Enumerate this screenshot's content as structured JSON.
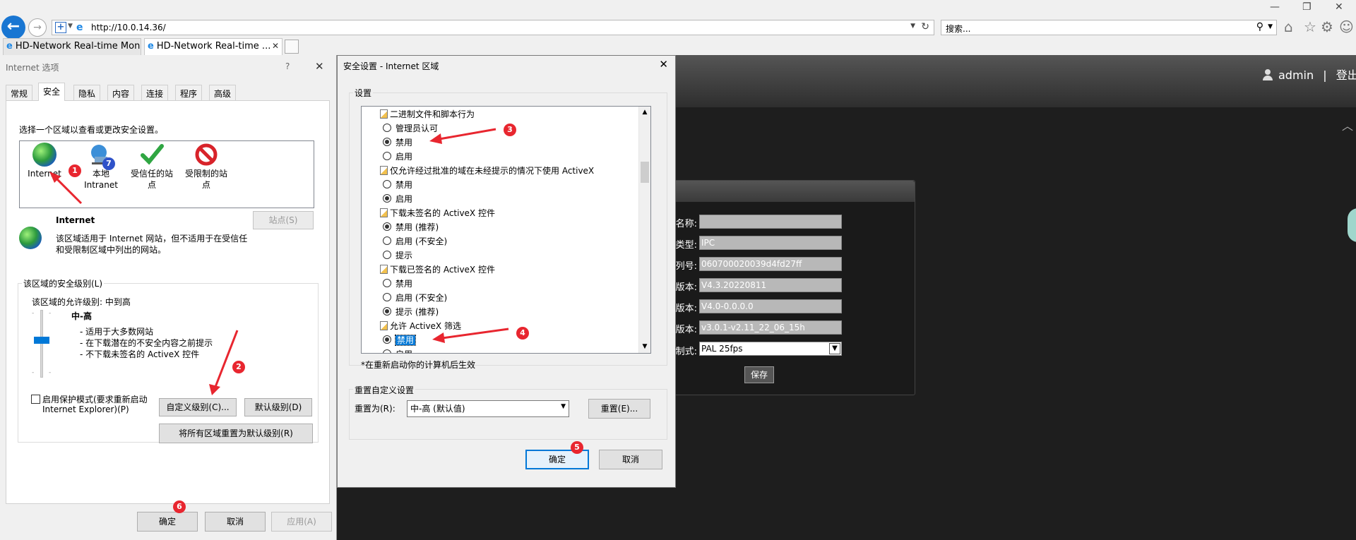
{
  "browser": {
    "url": "http://10.0.14.36/",
    "search_placeholder": "搜索...",
    "tabs": [
      {
        "label": "HD-Network Real-time Mon..."
      },
      {
        "label": "HD-Network Real-time ..."
      }
    ]
  },
  "web": {
    "user": "admin",
    "separator": "|",
    "logout": "登出",
    "labels": [
      "名称:",
      "类型:",
      "列号:",
      "版本:",
      "版本:",
      "版本:",
      "制式:"
    ],
    "fields": [
      "",
      "IPC",
      "060700020039d4fd27ff",
      "V4.3.20220811",
      "V4.0-0.0.0.0",
      "v3.0.1-v2.11_22_06_15h"
    ],
    "format_value": "PAL 25fps",
    "save_label": "保存"
  },
  "options_dialog": {
    "title": "Internet 选项",
    "help": "?",
    "tabs": [
      "常规",
      "安全",
      "隐私",
      "内容",
      "连接",
      "程序",
      "高级"
    ],
    "zone_prompt": "选择一个区域以查看或更改安全设置。",
    "zones": [
      {
        "label": "Internet"
      },
      {
        "label_line1": "本地",
        "label_line2": "Intranet"
      },
      {
        "label_line1": "受信任的站",
        "label_line2": "点"
      },
      {
        "label_line1": "受限制的站",
        "label_line2": "点"
      }
    ],
    "zone_name": "Internet",
    "sites_button": "站点(S)",
    "zone_desc_line1": "该区域适用于 Internet 网站，但不适用于在受信任",
    "zone_desc_line2": "和受限制区域中列出的网站。",
    "level_group": "该区域的安全级别(L)",
    "allowed_level": "该区域的允许级别: 中到高",
    "level_name": "中-高",
    "level_points": [
      "- 适用于大多数网站",
      "- 在下载潜在的不安全内容之前提示",
      "- 不下载未签名的 ActiveX 控件"
    ],
    "protected_mode_line1": "启用保护模式(要求重新启动",
    "protected_mode_line2": "Internet Explorer)(P)",
    "custom_level_button": "自定义级别(C)...",
    "default_level_button": "默认级别(D)",
    "reset_all_button": "将所有区域重置为默认级别(R)",
    "ok": "确定",
    "cancel": "取消",
    "apply": "应用(A)"
  },
  "security_dialog": {
    "title": "安全设置 - Internet 区域",
    "group_settings": "设置",
    "items": [
      {
        "type": "head",
        "text": "二进制文件和脚本行为"
      },
      {
        "type": "opt",
        "text": "管理员认可",
        "checked": false
      },
      {
        "type": "opt",
        "text": "禁用",
        "checked": true
      },
      {
        "type": "opt",
        "text": "启用",
        "checked": false
      },
      {
        "type": "head",
        "text": "仅允许经过批准的域在未经提示的情况下使用 ActiveX"
      },
      {
        "type": "opt",
        "text": "禁用",
        "checked": false
      },
      {
        "type": "opt",
        "text": "启用",
        "checked": true
      },
      {
        "type": "head",
        "text": "下载未签名的 ActiveX 控件"
      },
      {
        "type": "opt",
        "text": "禁用 (推荐)",
        "checked": true
      },
      {
        "type": "opt",
        "text": "启用 (不安全)",
        "checked": false
      },
      {
        "type": "opt",
        "text": "提示",
        "checked": false
      },
      {
        "type": "head",
        "text": "下载已签名的 ActiveX 控件"
      },
      {
        "type": "opt",
        "text": "禁用",
        "checked": false
      },
      {
        "type": "opt",
        "text": "启用 (不安全)",
        "checked": false
      },
      {
        "type": "opt",
        "text": "提示 (推荐)",
        "checked": true
      },
      {
        "type": "head",
        "text": "允许 ActiveX 筛选"
      },
      {
        "type": "opt",
        "text": "禁用",
        "checked": true,
        "selected": true
      },
      {
        "type": "opt",
        "text": "启用",
        "checked": false
      }
    ],
    "restart_note": "*在重新启动你的计算机后生效",
    "reset_group": "重置自定义设置",
    "reset_to_label": "重置为(R):",
    "reset_value": "中-高 (默认值)",
    "reset_button": "重置(E)...",
    "ok": "确定",
    "cancel": "取消"
  },
  "annotations": [
    "1",
    "2",
    "3",
    "4",
    "5",
    "6",
    "7"
  ],
  "colors": {
    "annotation": "#e8262f",
    "accent": "#0078d7",
    "browser_back": "#1976d2"
  }
}
